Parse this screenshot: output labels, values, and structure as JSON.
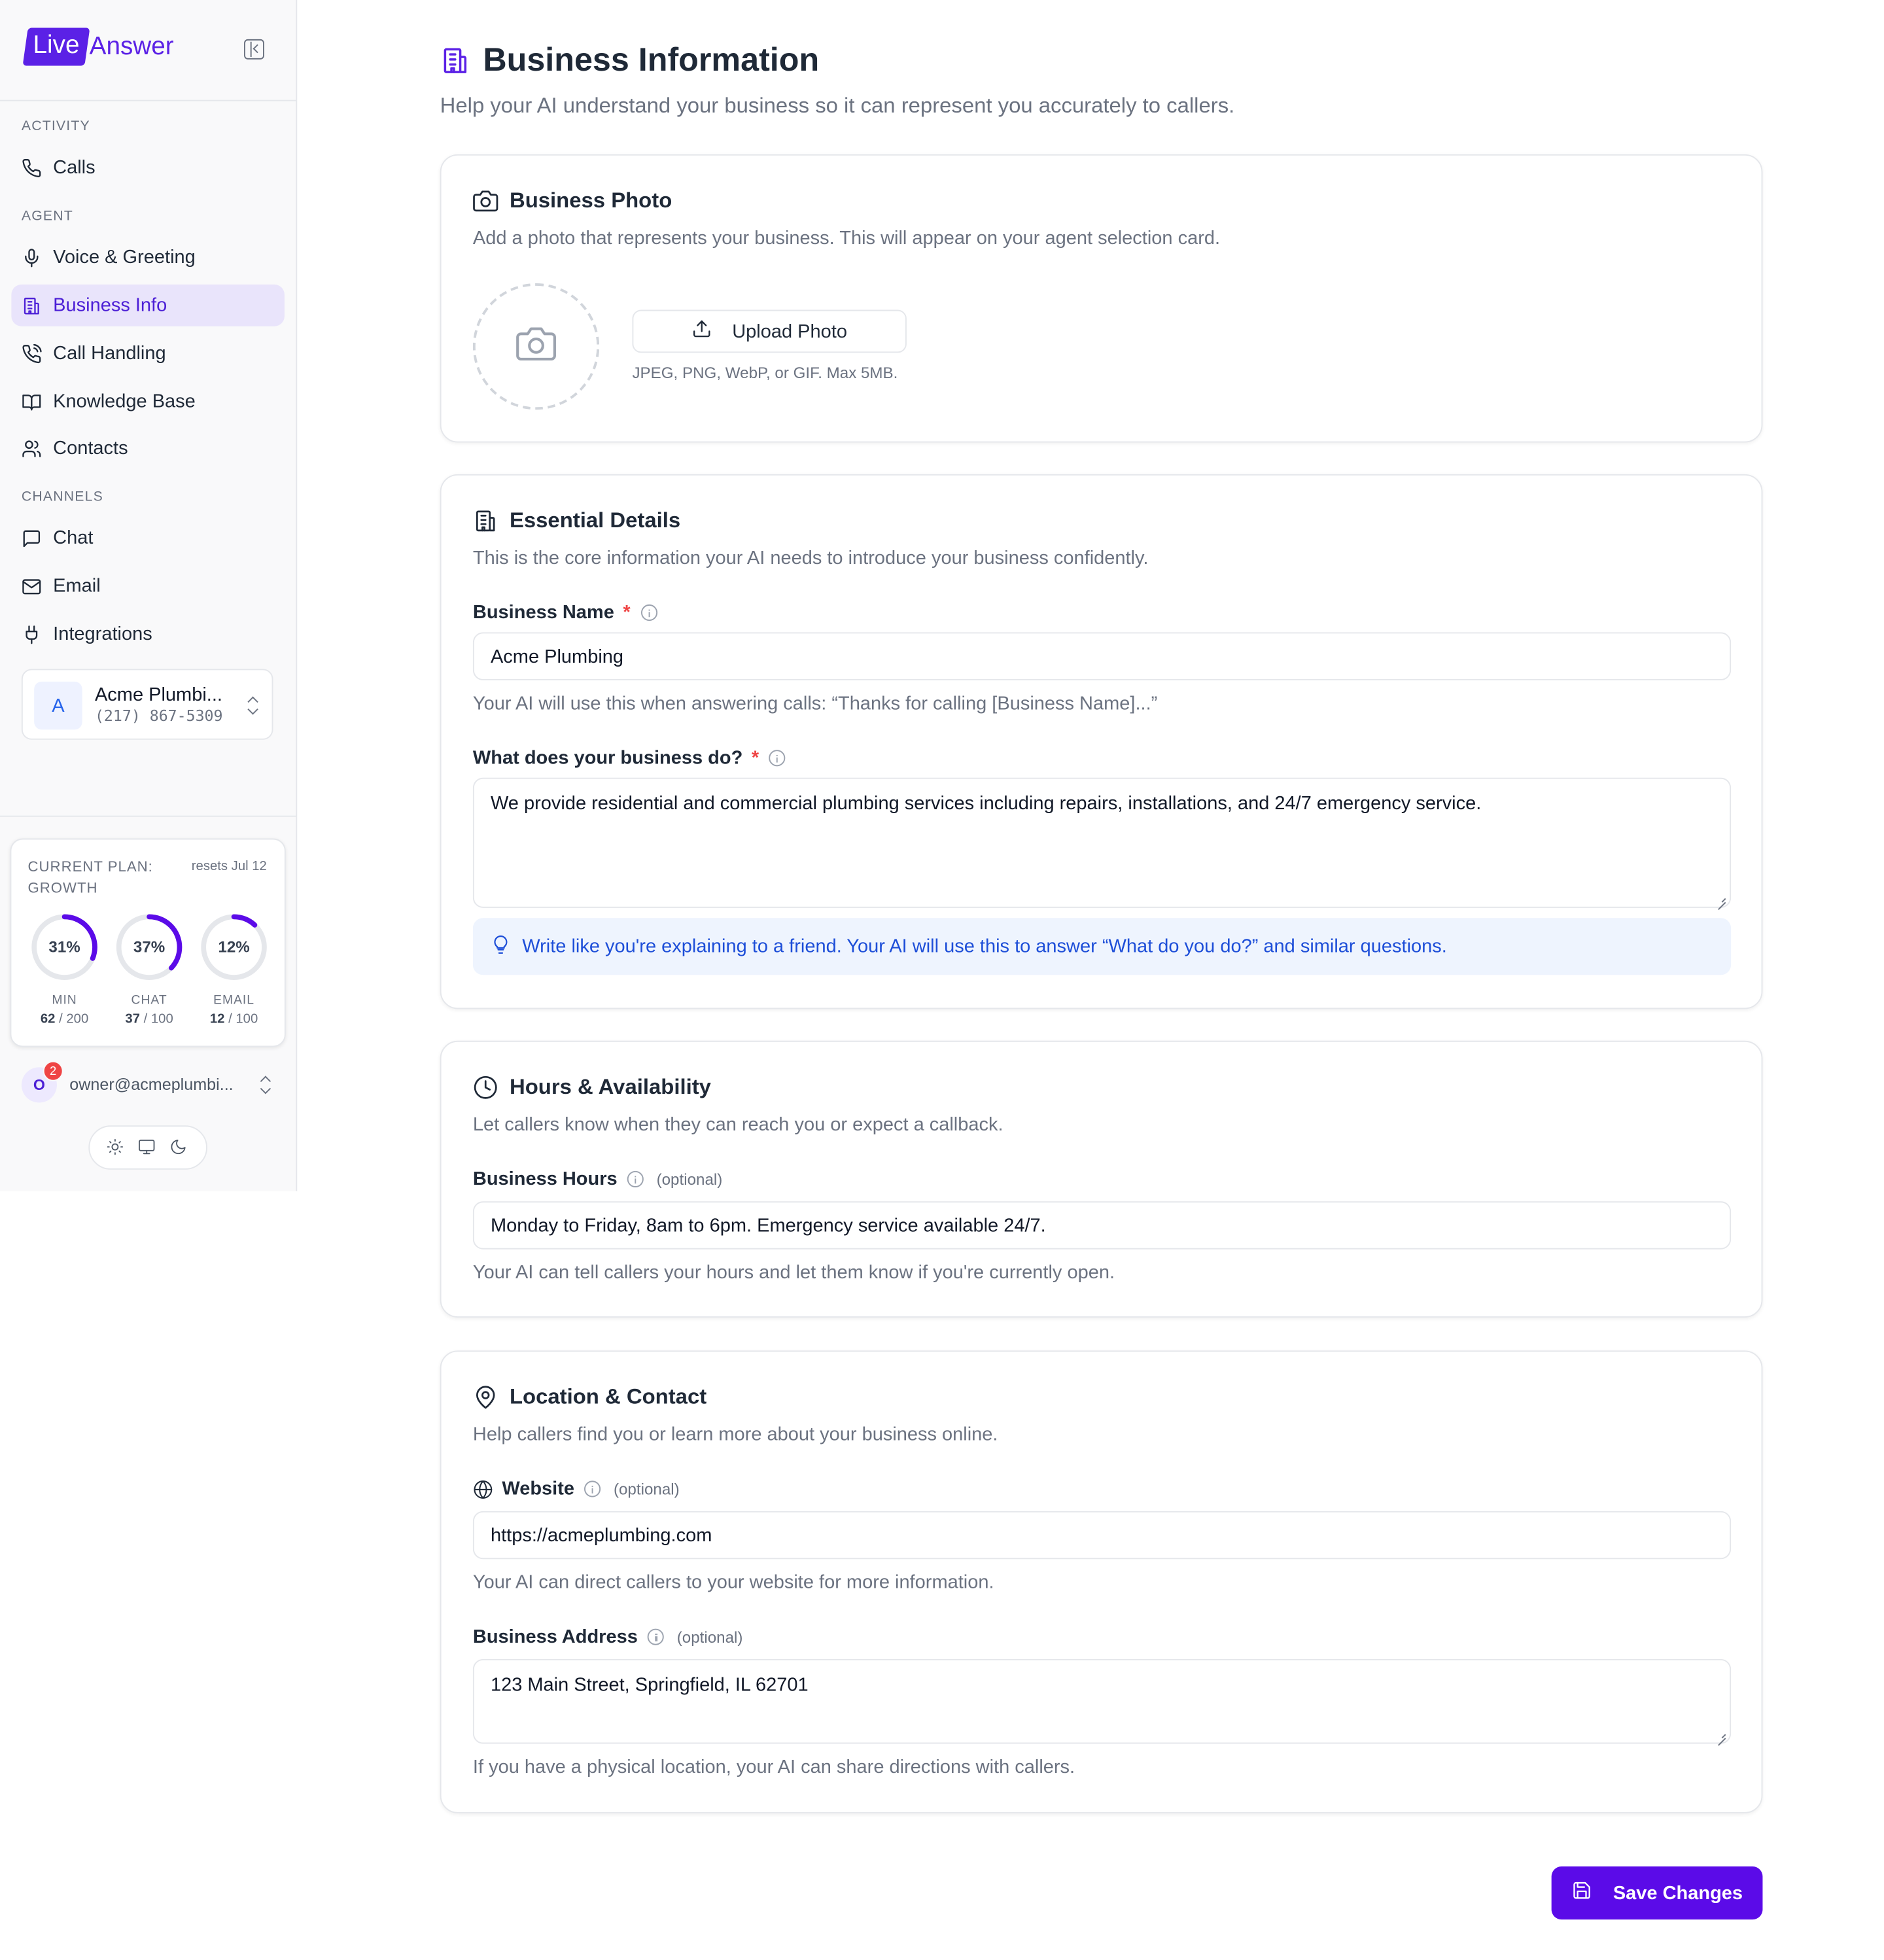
{
  "brand": {
    "logo_badge": "Live",
    "logo_text": "Answer",
    "accent": "#5b21e6"
  },
  "sidebar": {
    "sections": [
      {
        "label": "ACTIVITY"
      },
      {
        "label": "AGENT"
      },
      {
        "label": "CHANNELS"
      }
    ],
    "items": [
      {
        "label": "Calls",
        "icon": "phone-icon"
      },
      {
        "label": "Voice & Greeting",
        "icon": "mic-icon"
      },
      {
        "label": "Business Info",
        "icon": "building-icon",
        "active": true
      },
      {
        "label": "Call Handling",
        "icon": "phone-call-icon"
      },
      {
        "label": "Knowledge Base",
        "icon": "book-icon"
      },
      {
        "label": "Contacts",
        "icon": "users-icon"
      },
      {
        "label": "Chat",
        "icon": "chat-icon"
      },
      {
        "label": "Email",
        "icon": "mail-icon"
      },
      {
        "label": "Integrations",
        "icon": "plug-icon"
      }
    ],
    "business": {
      "avatar": "A",
      "name": "Acme Plumbi...",
      "phone": "(217) 867-5309"
    },
    "plan": {
      "title": "CURRENT PLAN: GROWTH",
      "reset": "resets Jul 12",
      "usage": [
        {
          "pct_label": "31%",
          "fraction": 0.31,
          "label": "MIN",
          "used": "62",
          "limit": " / 200"
        },
        {
          "pct_label": "37%",
          "fraction": 0.37,
          "label": "CHAT",
          "used": "37",
          "limit": " / 100"
        },
        {
          "pct_label": "12%",
          "fraction": 0.12,
          "label": "EMAIL",
          "used": "12",
          "limit": " / 100"
        }
      ]
    },
    "user": {
      "avatar": "O",
      "badge": "2",
      "email": "owner@acmeplumbi..."
    }
  },
  "main": {
    "title": "Business Information",
    "subtitle": "Help your AI understand your business so it can represent you accurately to callers.",
    "photo_card": {
      "title": "Business Photo",
      "desc": "Add a photo that represents your business. This will appear on your agent selection card.",
      "upload_label": "Upload Photo",
      "upload_hint": "JPEG, PNG, WebP, or GIF. Max 5MB."
    },
    "essential_card": {
      "title": "Essential Details",
      "desc": "This is the core information your AI needs to introduce your business confidently.",
      "name_label": "Business Name",
      "name_value": "Acme Plumbing",
      "name_help": "Your AI will use this when answering calls: “Thanks for calling [Business Name]...”",
      "do_label": "What does your business do?",
      "do_value": "We provide residential and commercial plumbing services including repairs, installations, and 24/7 emergency service.",
      "tip": "Write like you're explaining to a friend. Your AI will use this to answer “What do you do?” and similar questions.",
      "required_mark": "*"
    },
    "hours_card": {
      "title": "Hours & Availability",
      "desc": "Let callers know when they can reach you or expect a callback.",
      "hours_label": "Business Hours",
      "optional": "(optional)",
      "hours_value": "Monday to Friday, 8am to 6pm. Emergency service available 24/7.",
      "hours_help": "Your AI can tell callers your hours and let them know if you're currently open."
    },
    "location_card": {
      "title": "Location & Contact",
      "desc": "Help callers find you or learn more about your business online.",
      "website_label": "Website",
      "website_value": "https://acmeplumbing.com",
      "website_help": "Your AI can direct callers to your website for more information.",
      "address_label": "Business Address",
      "address_value": "123 Main Street, Springfield, IL 62701",
      "address_help": "If you have a physical location, your AI can share directions with callers.",
      "optional": "(optional)"
    },
    "save_label": "Save Changes"
  }
}
